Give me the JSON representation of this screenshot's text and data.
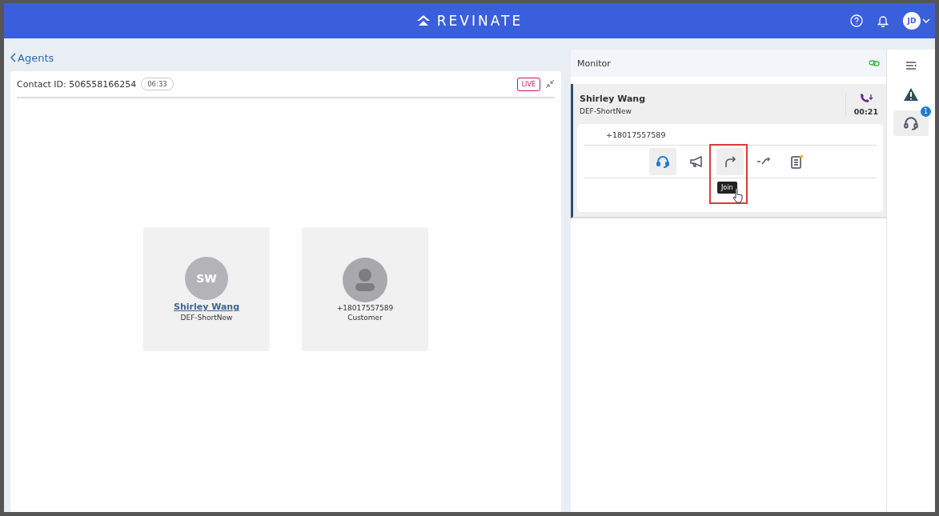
{
  "header": {
    "logo": "REVINATE",
    "avatar": "JD"
  },
  "back_link": "Agents",
  "contact": {
    "label": "Contact ID: 506558166254",
    "duration": "06:33",
    "live_badge": "LIVE",
    "participants": [
      {
        "kind": "agent",
        "initials": "SW",
        "name": "Shirley Wang",
        "detail": "DEF-ShortNew"
      },
      {
        "kind": "customer",
        "name": "+18017557589",
        "detail": "Customer"
      }
    ]
  },
  "monitor": {
    "title": "Monitor",
    "call": {
      "agent": "Shirley Wang",
      "queue": "DEF-ShortNew",
      "timer": "00:21",
      "phone": "+18017557589",
      "actions": [
        {
          "kind": "listen",
          "selected": true,
          "highlighted": false
        },
        {
          "kind": "announce",
          "selected": false,
          "highlighted": false
        },
        {
          "kind": "join",
          "selected": true,
          "highlighted": true,
          "tooltip": "Join"
        },
        {
          "kind": "transfer",
          "selected": false,
          "highlighted": false
        },
        {
          "kind": "notes",
          "selected": false,
          "highlighted": false
        }
      ]
    }
  },
  "sidebar": {
    "items": [
      {
        "kind": "menu",
        "selected": false
      },
      {
        "kind": "alert",
        "selected": false
      },
      {
        "kind": "headset",
        "selected": true,
        "badge": "1"
      }
    ]
  }
}
